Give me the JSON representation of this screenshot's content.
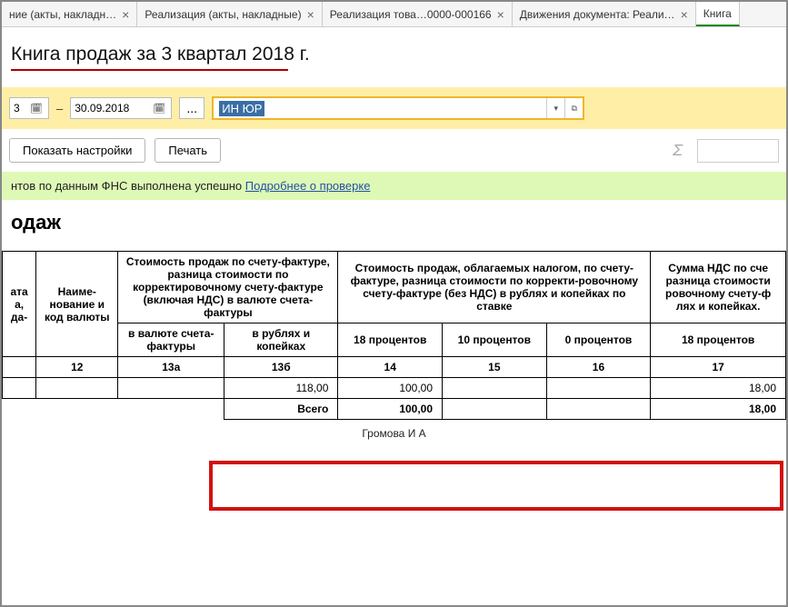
{
  "tabs": [
    {
      "label": "ние (акты, накладн…",
      "closable": true
    },
    {
      "label": "Реализация (акты, накладные)",
      "closable": true
    },
    {
      "label": "Реализация това…0000-000166",
      "closable": true
    },
    {
      "label": "Движения документа: Реали…",
      "closable": true
    },
    {
      "label": "Книга",
      "closable": false
    }
  ],
  "page_title": "Книга продаж за 3 квартал 2018 г.",
  "filter": {
    "date_left_partial": "3",
    "dash": "–",
    "date_right": "30.09.2018",
    "dots": "...",
    "select_highlight": "ИН ЮР",
    "dropdown": "▾",
    "expand": "⧉"
  },
  "actions": {
    "settings": "Показать настройки",
    "print": "Печать",
    "sigma": "Σ"
  },
  "status": {
    "text": "нтов по данным ФНС выполнена успешно ",
    "link": "Подробнее о проверке"
  },
  "report": {
    "heading_partial": "одаж",
    "col_left1": "ата а, да-",
    "col_name": "Наиме-нование и код валюты",
    "group1": "Стоимость продаж по счету-фактуре, разница стоимости по корректировочному счету-фактуре (включая НДС) в валюте счета-фактуры",
    "group1_sub1": "в валюте счета-фактуры",
    "group1_sub2": "в рублях и копейках",
    "group2": "Стоимость продаж, облагаемых налогом, по счету-фактуре, разница стоимости по корректи-ровочному счету-фактуре (без НДС) в рублях и копейках по ставке",
    "group2_sub1": "18 процентов",
    "group2_sub2": "10 процентов",
    "group2_sub3": "0 процентов",
    "group3": "Сумма НДС по сче разница стоимости ровочному счету-ф лях и копейках.",
    "group3_sub1": "18 процентов",
    "nums": {
      "c12": "12",
      "c13a": "13а",
      "c13b": "13б",
      "c14": "14",
      "c15": "15",
      "c16": "16",
      "c17": "17"
    },
    "row1": {
      "c13b": "118,00",
      "c14": "100,00",
      "c17": "18,00"
    },
    "total_label": "Всего",
    "total": {
      "c14": "100,00",
      "c17": "18,00"
    },
    "footer": "Громова И   А"
  }
}
